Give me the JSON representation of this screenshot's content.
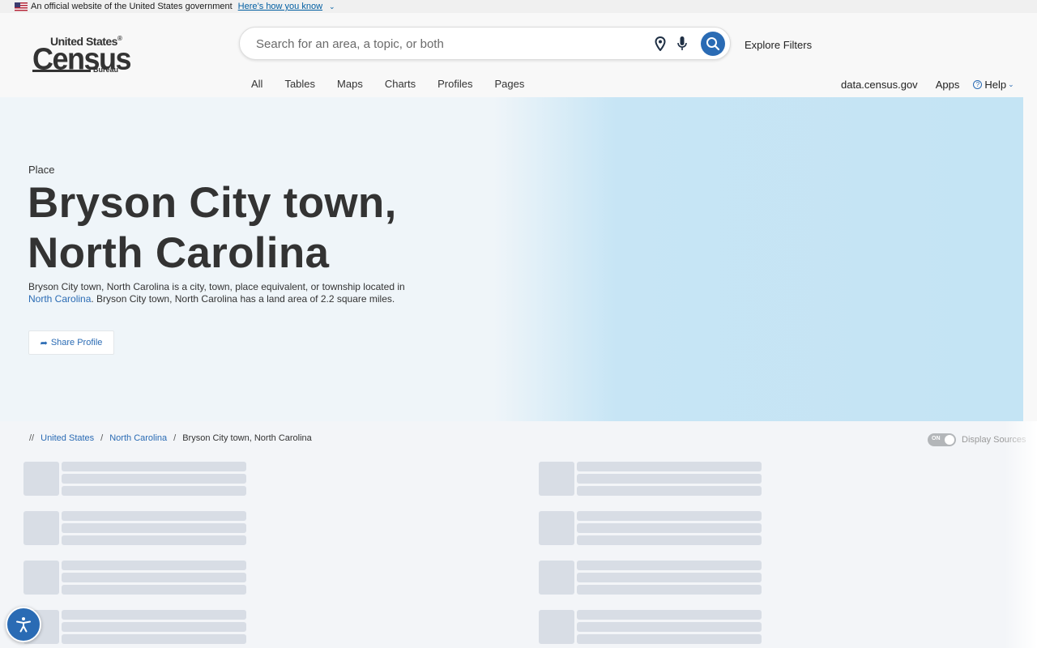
{
  "gov_banner": {
    "text": "An official website of the United States government",
    "link": "Here’s how you know"
  },
  "logo": {
    "line1": "United States",
    "line2": "Census",
    "line3": "Bureau",
    "registered": "®"
  },
  "search": {
    "placeholder": "Search for an area, a topic, or both"
  },
  "header": {
    "explore_filters": "Explore Filters",
    "tabs": [
      "All",
      "Tables",
      "Maps",
      "Charts",
      "Profiles",
      "Pages"
    ],
    "right_nav": {
      "data": "data.census.gov",
      "apps": "Apps",
      "help": "Help"
    }
  },
  "hero": {
    "label": "Place",
    "title": "Bryson City town, North Carolina",
    "desc_before": "Bryson City town, North Carolina is a city, town, place equivalent, or township located in ",
    "desc_link": "North Carolina",
    "desc_after": ". Bryson City town, North Carolina has a land area of 2.2 square miles.",
    "share": "Share Profile"
  },
  "breadcrumb": {
    "lead": "//",
    "items": [
      "United States",
      "North Carolina",
      "Bryson City town, North Carolina"
    ]
  },
  "sources_toggle": {
    "state": "ON",
    "label": "Display Sources"
  },
  "colors": {
    "accent": "#2a6bb4",
    "hero_left": "#eff5f9",
    "hero_right": "#c4e4f4",
    "skeleton": "#d8dde5"
  }
}
